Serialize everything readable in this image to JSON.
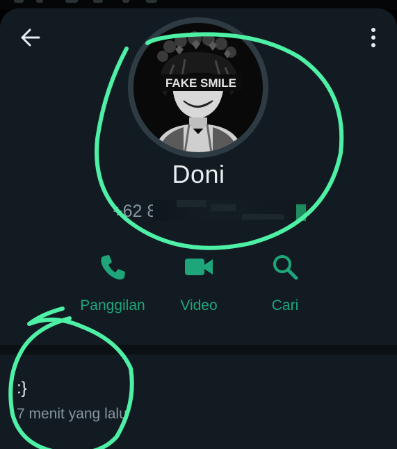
{
  "header": {
    "back_icon": "arrow-left-icon",
    "menu_icon": "more-vertical-icon"
  },
  "profile": {
    "name": "Doni",
    "phone_visible": "+62 8",
    "avatar_caption": "FAKE SMILE"
  },
  "actions": [
    {
      "label": "Panggilan",
      "icon": "phone-icon"
    },
    {
      "label": "Video",
      "icon": "video-camera-icon"
    },
    {
      "label": "Cari",
      "icon": "search-icon"
    }
  ],
  "about": {
    "text": ":}",
    "time": "7 menit yang lalu"
  },
  "colors": {
    "background": "#121b22",
    "accent": "#1ea67a",
    "annotation": "#4ef0a6",
    "primary_text": "#e9edef",
    "secondary_text": "#8696a0"
  }
}
